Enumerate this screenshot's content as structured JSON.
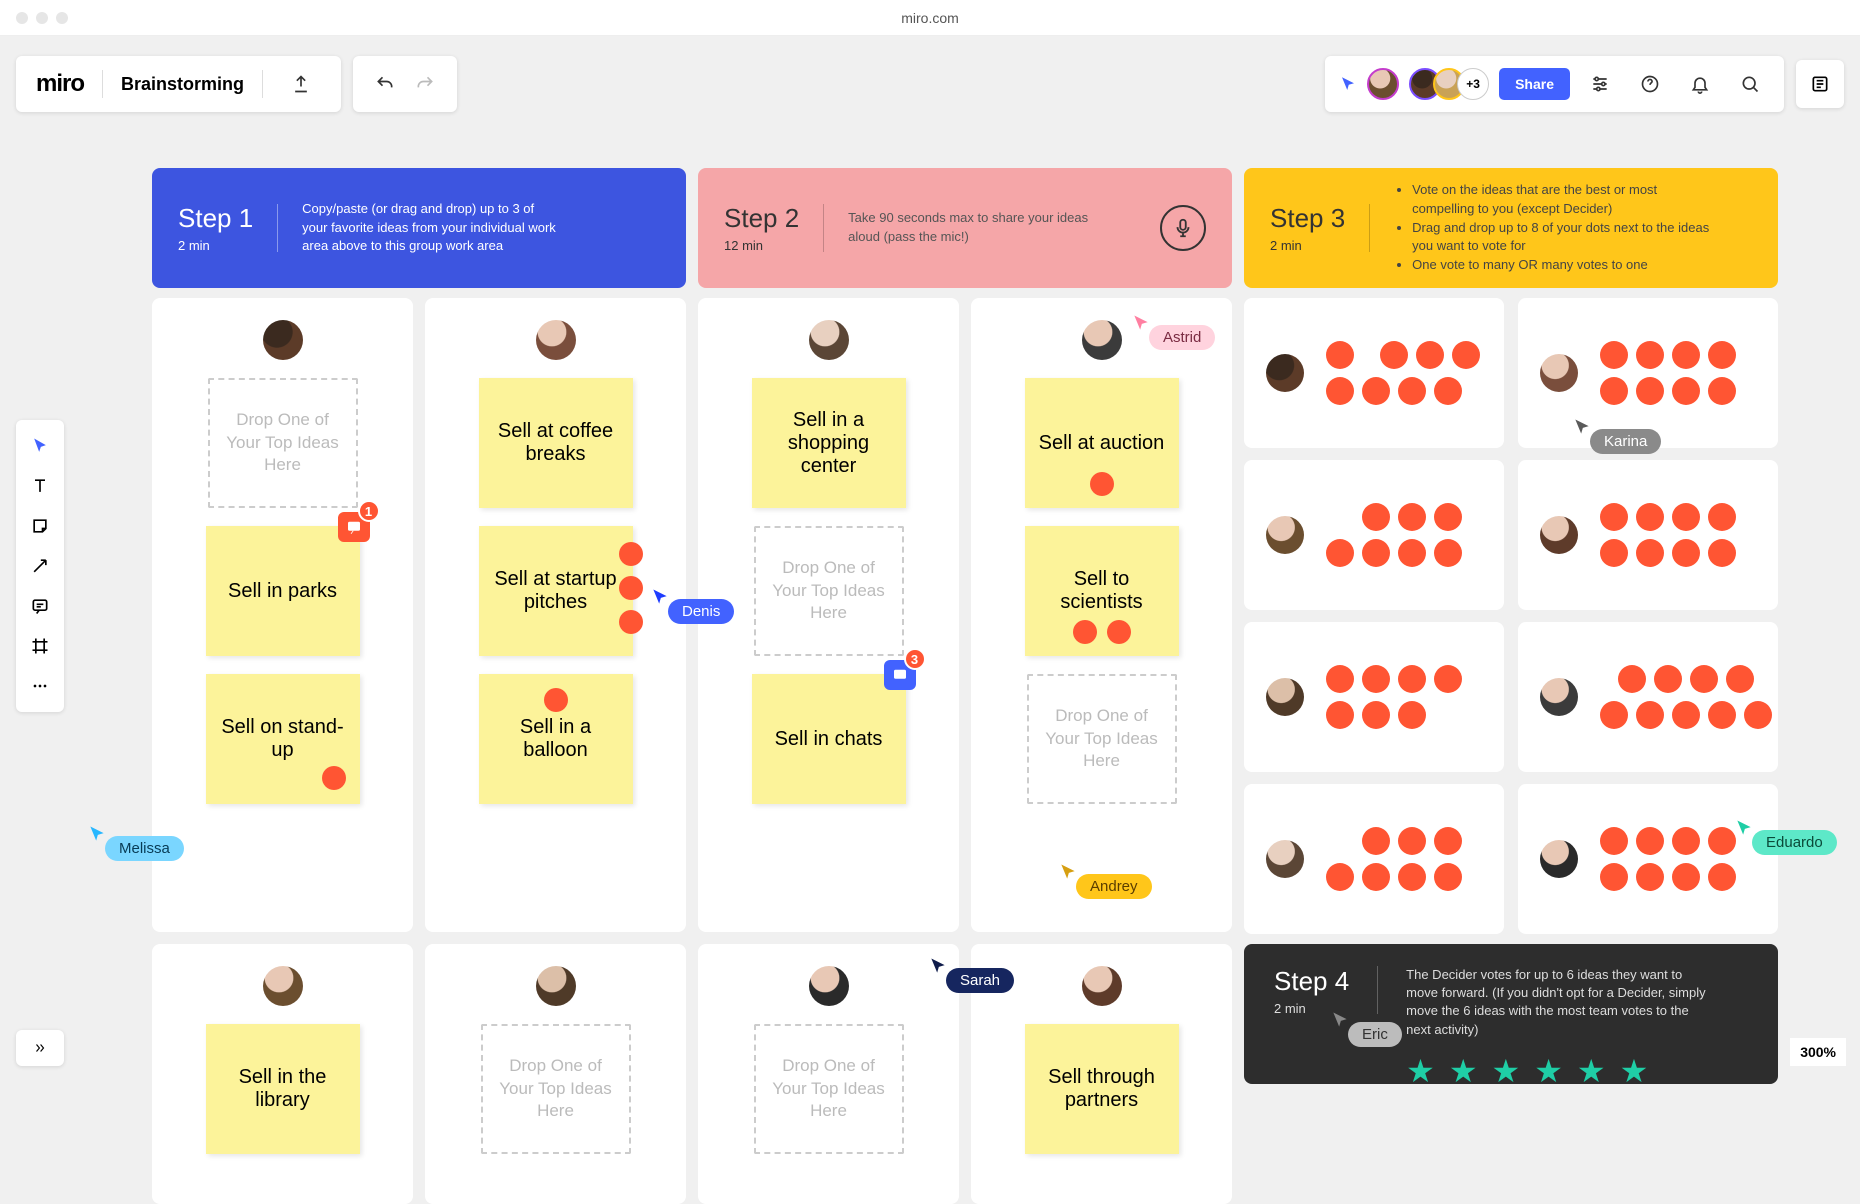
{
  "browser": {
    "url": "miro.com"
  },
  "header": {
    "logo": "miro",
    "board_name": "Brainstorming",
    "share": "Share",
    "overflow": "+3"
  },
  "zoom": "300%",
  "placeholder": "Drop One of Your Top Ideas Here",
  "steps": {
    "s1": {
      "title": "Step 1",
      "time": "2 min",
      "desc": "Copy/paste (or drag and drop) up to 3 of your favorite ideas from your individual work area above to this group work area"
    },
    "s2": {
      "title": "Step 2",
      "time": "12 min",
      "desc": "Take 90 seconds max to share your ideas aloud (pass the mic!)"
    },
    "s3": {
      "title": "Step 3",
      "time": "2 min",
      "li1": "Vote on the ideas that are the best or most compelling to you (except Decider)",
      "li2": "Drag and drop up to 8 of your dots next to the ideas you want to vote for",
      "li3": "One vote to many OR many votes to one"
    },
    "s4": {
      "title": "Step 4",
      "time": "2 min",
      "desc": "The Decider votes for up to 6 ideas they want to move forward. (If you didn't opt for a Decider, simply move the 6 ideas with the most team votes to the next activity)"
    }
  },
  "notes": {
    "parks": "Sell in parks",
    "standup": "Sell on stand-up",
    "coffee": "Sell at coffee breaks",
    "startup": "Sell at startup pitches",
    "balloon": "Sell in a balloon",
    "shopping": "Sell in a shopping center",
    "chats": "Sell in chats",
    "auction": "Sell at auction",
    "scientists": "Sell to scientists",
    "library": "Sell in the library",
    "partners": "Sell through partners"
  },
  "cursors": {
    "melissa": "Melissa",
    "denis": "Denis",
    "astrid": "Astrid",
    "andrey": "Andrey",
    "sarah": "Sarah",
    "karina": "Karina",
    "eduardo": "Eduardo",
    "eric": "Eric"
  },
  "comments": {
    "c1": "1",
    "c3": "3"
  },
  "avatars": {
    "a1": "radial-gradient(circle at 35% 30%, #3b2a1f 0 40%, #5c3b28 42% 100%)",
    "a2": "radial-gradient(circle at 40% 30%, #e8c8b5 0 38%, #7a4e3c 40% 100%)",
    "a3": "radial-gradient(circle at 40% 30%, #e8d0c0 0 38%, #5b4636 40% 100%)",
    "a4": "radial-gradient(circle at 40% 30%, #e8c8b5 0 38%, #3b3b3b 40% 100%)",
    "a5": "radial-gradient(circle at 40% 30%, #e8c8b5 0 38%, #6b4e2f 40% 100%)",
    "a6": "radial-gradient(circle at 40% 30%, #dcbfa8 0 38%, #4f3a28 40% 100%)",
    "a7": "radial-gradient(circle at 40% 30%, #e8c8b5 0 38%, #2a2a2a 40% 100%)",
    "a8": "radial-gradient(circle at 40% 30%, #e8c8b5 0 38%, #5e3b2a 40% 100%)"
  },
  "colors": {
    "cursor_lite_blue": {
      "ptr": "#27b7ff",
      "bg": "#7ad6ff",
      "fg": "#083b55"
    },
    "cursor_blue": {
      "ptr": "#1e3cff",
      "bg": "#4262ff",
      "fg": "#fff"
    },
    "cursor_pink": {
      "ptr": "#ff7fa1",
      "bg": "#ffd3de",
      "fg": "#7a2b42"
    },
    "cursor_amber": {
      "ptr": "#d69f11",
      "bg": "#ffc61a",
      "fg": "#5a3d00"
    },
    "cursor_navy": {
      "ptr": "#0f1c4b",
      "bg": "#16265f",
      "fg": "#fff"
    },
    "cursor_gray": {
      "ptr": "#5a5a5a",
      "bg": "#8a8a8a",
      "fg": "#fff"
    },
    "cursor_green": {
      "ptr": "#1fcea6",
      "bg": "#5de8c8",
      "fg": "#0a4a39"
    }
  }
}
